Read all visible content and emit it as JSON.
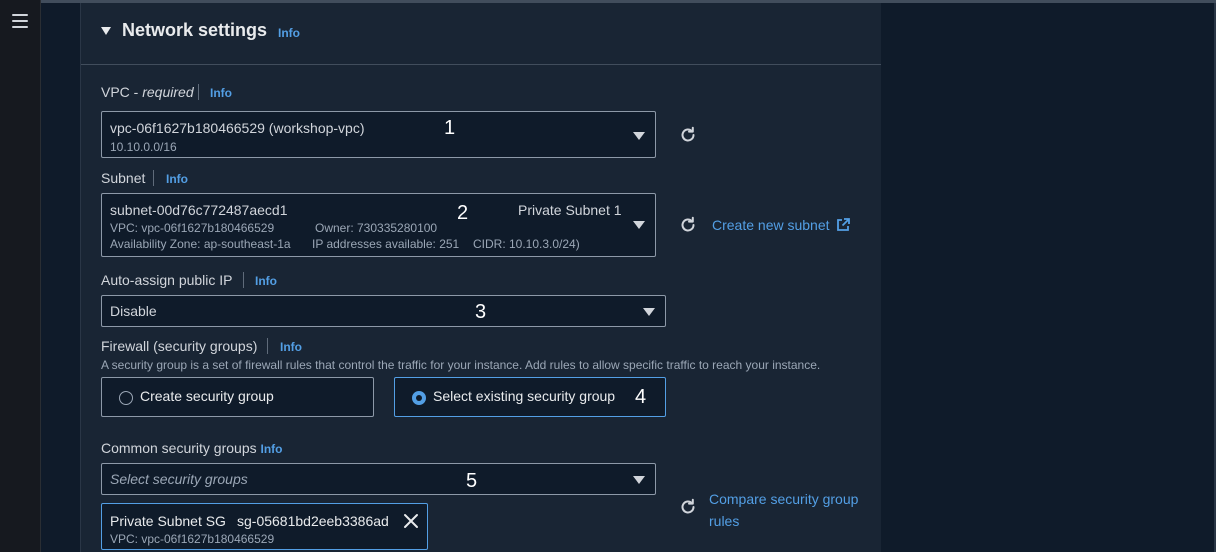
{
  "section": {
    "title": "Network settings",
    "info": "Info"
  },
  "vpc": {
    "label": "VPC - ",
    "required": "required",
    "info": "Info",
    "value": "vpc-06f1627b180466529 (workshop-vpc)",
    "cidr": "10.10.0.0/16",
    "annotation": "1"
  },
  "subnet": {
    "label": "Subnet",
    "info": "Info",
    "value": "subnet-00d76c772487aecd1",
    "name": "Private Subnet 1",
    "vpc_line": "VPC: vpc-06f1627b180466529",
    "owner_line": "Owner: 730335280100",
    "az_line": "Availability Zone: ap-southeast-1a",
    "ips_line": "IP addresses available: 251",
    "cidr_line": "CIDR: 10.10.3.0/24)",
    "annotation": "2",
    "create_link": "Create new subnet"
  },
  "public_ip": {
    "label": "Auto-assign public IP",
    "info": "Info",
    "value": "Disable",
    "annotation": "3"
  },
  "firewall": {
    "label": "Firewall (security groups)",
    "info": "Info",
    "description": "A security group is a set of firewall rules that control the traffic for your instance. Add rules to allow specific traffic to reach your instance.",
    "options": [
      {
        "label": "Create security group",
        "selected": false
      },
      {
        "label": "Select existing security group",
        "selected": true
      }
    ],
    "annotation": "4"
  },
  "common_sg": {
    "label": "Common security groups",
    "info": "Info",
    "placeholder": "Select security groups",
    "annotation": "5",
    "compare_link_line1": "Compare security group",
    "compare_link_line2": "rules",
    "selected": [
      {
        "name": "Private Subnet SG",
        "id": "sg-05681bd2eeb3386ad",
        "vpc": "VPC: vpc-06f1627b180466529"
      }
    ]
  },
  "colors": {
    "accent": "#539fe5",
    "panel": "#192534",
    "page": "#0f1b2a"
  },
  "icons": [
    "menu-icon",
    "caret-down-icon",
    "refresh-icon",
    "external-link-icon",
    "close-icon"
  ]
}
